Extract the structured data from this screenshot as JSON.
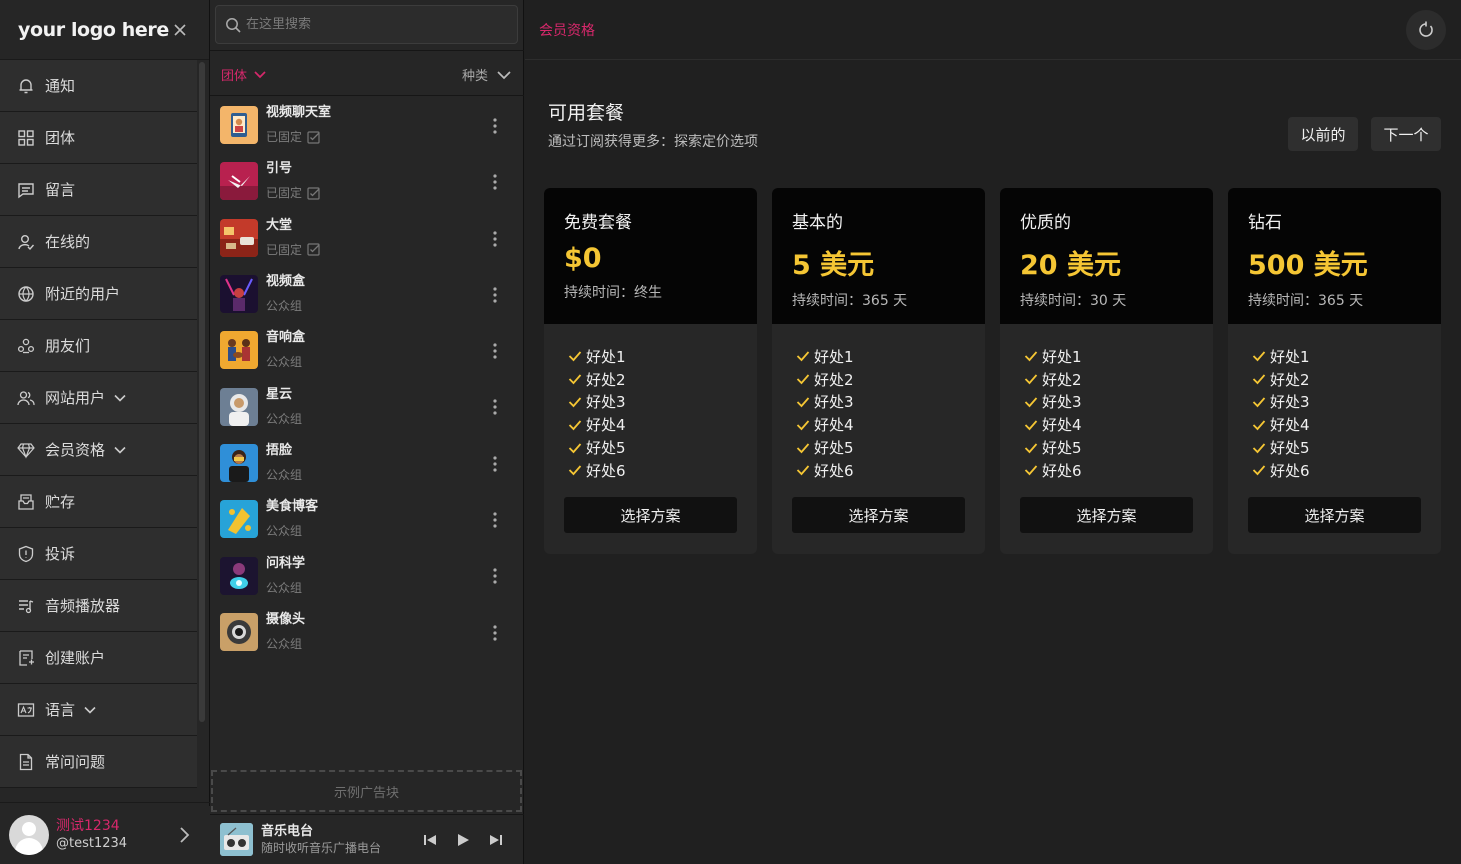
{
  "brand": {
    "logo_text": "your logo here"
  },
  "nav": {
    "items": [
      {
        "label": "通知",
        "icon": "bell-icon",
        "has_chevron": false
      },
      {
        "label": "团体",
        "icon": "grid-icon",
        "has_chevron": false
      },
      {
        "label": "留言",
        "icon": "message-icon",
        "has_chevron": false
      },
      {
        "label": "在线的",
        "icon": "user-online-icon",
        "has_chevron": false
      },
      {
        "label": "附近的用户",
        "icon": "globe-icon",
        "has_chevron": false
      },
      {
        "label": "朋友们",
        "icon": "friends-icon",
        "has_chevron": false
      },
      {
        "label": "网站用户",
        "icon": "users-icon",
        "has_chevron": true
      },
      {
        "label": "会员资格",
        "icon": "diamond-icon",
        "has_chevron": true
      },
      {
        "label": "贮存",
        "icon": "storage-icon",
        "has_chevron": false
      },
      {
        "label": "投诉",
        "icon": "shield-icon",
        "has_chevron": false
      },
      {
        "label": "音频播放器",
        "icon": "playlist-icon",
        "has_chevron": false
      },
      {
        "label": "创建账户",
        "icon": "create-account-icon",
        "has_chevron": false
      },
      {
        "label": "语言",
        "icon": "language-icon",
        "has_chevron": true
      },
      {
        "label": "常问问题",
        "icon": "document-icon",
        "has_chevron": false
      }
    ]
  },
  "user": {
    "display_name": "测试1234",
    "handle": "@test1234"
  },
  "search": {
    "placeholder": "在这里搜索"
  },
  "filters": {
    "group_filter": "团体",
    "category_filter": "种类"
  },
  "groups": [
    {
      "name": "视频聊天室",
      "sub": "已固定",
      "pinned": true
    },
    {
      "name": "引号",
      "sub": "已固定",
      "pinned": true
    },
    {
      "name": "大堂",
      "sub": "已固定",
      "pinned": true
    },
    {
      "name": "视频盒",
      "sub": "公众组",
      "pinned": false
    },
    {
      "name": "音响盒",
      "sub": "公众组",
      "pinned": false
    },
    {
      "name": "星云",
      "sub": "公众组",
      "pinned": false
    },
    {
      "name": "捂脸",
      "sub": "公众组",
      "pinned": false
    },
    {
      "name": "美食博客",
      "sub": "公众组",
      "pinned": false
    },
    {
      "name": "问科学",
      "sub": "公众组",
      "pinned": false
    },
    {
      "name": "摄像头",
      "sub": "公众组",
      "pinned": false
    }
  ],
  "ad": {
    "label": "示例广告块"
  },
  "player": {
    "title": "音乐电台",
    "subtitle": "随时收听音乐广播电台"
  },
  "header": {
    "breadcrumb": "会员资格"
  },
  "page": {
    "title": "可用套餐",
    "subtitle": "通过订阅获得更多：探索定价选项",
    "prev_label": "以前的",
    "next_label": "下一个"
  },
  "plans": [
    {
      "name": "免费套餐",
      "price": "$0",
      "duration": "持续时间：终生",
      "benefits": [
        "好处1",
        "好处2",
        "好处3",
        "好处4",
        "好处5",
        "好处6"
      ],
      "button": "选择方案"
    },
    {
      "name": "基本的",
      "price": "5 美元",
      "duration": "持续时间：365 天",
      "benefits": [
        "好处1",
        "好处2",
        "好处3",
        "好处4",
        "好处5",
        "好处6"
      ],
      "button": "选择方案"
    },
    {
      "name": "优质的",
      "price": "20 美元",
      "duration": "持续时间：30 天",
      "benefits": [
        "好处1",
        "好处2",
        "好处3",
        "好处4",
        "好处5",
        "好处6"
      ],
      "button": "选择方案"
    },
    {
      "name": "钻石",
      "price": "500 美元",
      "duration": "持续时间：365 天",
      "benefits": [
        "好处1",
        "好处2",
        "好处3",
        "好处4",
        "好处5",
        "好处6"
      ],
      "button": "选择方案"
    }
  ],
  "colors": {
    "accent": "#d6286b",
    "price": "#f5c634",
    "check": "#f5c634"
  }
}
